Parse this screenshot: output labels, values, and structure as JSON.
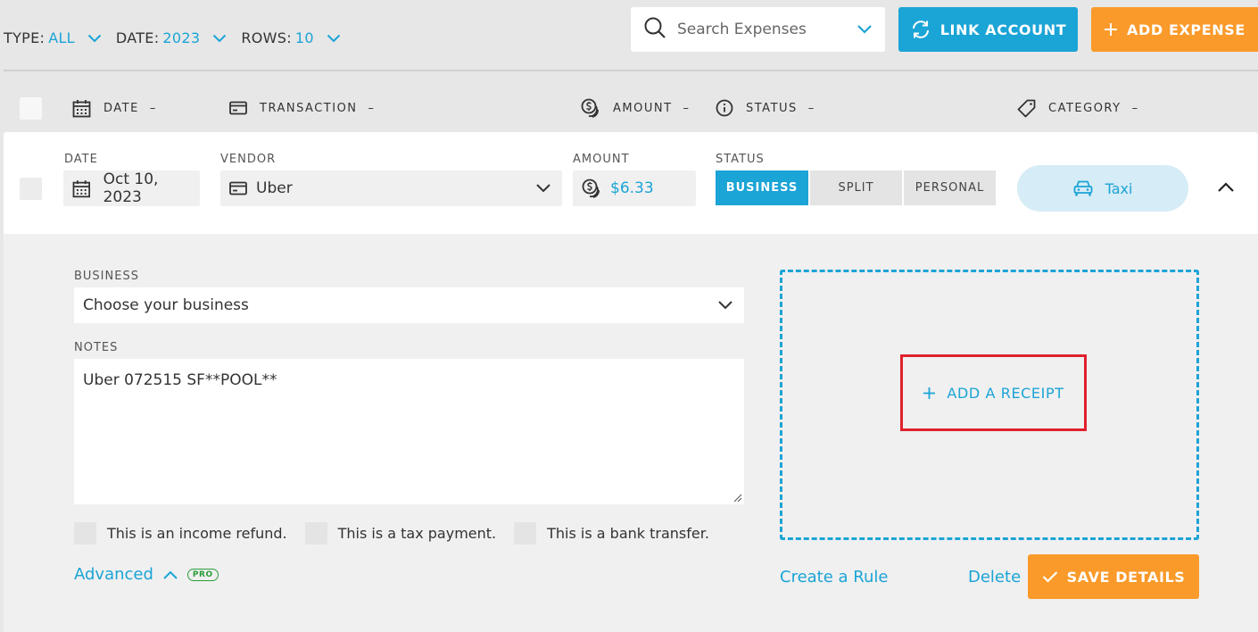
{
  "filters": [
    {
      "key": "TYPE:",
      "value": "ALL"
    },
    {
      "key": "DATE:",
      "value": "2023"
    },
    {
      "key": "ROWS:",
      "value": "10"
    }
  ],
  "search": {
    "placeholder": "Search Expenses"
  },
  "toolbar": {
    "link_account": "LINK ACCOUNT",
    "add_expense": "ADD EXPENSE"
  },
  "columns": {
    "date": "DATE",
    "transaction": "TRANSACTION",
    "amount": "AMOUNT",
    "status": "STATUS",
    "category": "CATEGORY",
    "sort_indicator": "–"
  },
  "expense": {
    "labels": {
      "date": "DATE",
      "vendor": "VENDOR",
      "amount": "AMOUNT",
      "status": "STATUS"
    },
    "date": "Oct 10, 2023",
    "vendor": "Uber",
    "amount": "$6.33",
    "status_options": [
      "BUSINESS",
      "SPLIT",
      "PERSONAL"
    ],
    "status_selected": "BUSINESS",
    "category": "Taxi"
  },
  "details": {
    "business_label": "BUSINESS",
    "business_value": "Choose your business",
    "notes_label": "NOTES",
    "notes_value": "Uber 072515 SF**POOL**",
    "checkboxes": [
      "This is an income refund.",
      "This is a tax payment.",
      "This is a bank transfer."
    ],
    "advanced": "Advanced",
    "pro_badge": "PRO",
    "add_receipt": "ADD A RECEIPT",
    "create_rule": "Create a Rule",
    "delete": "Delete",
    "save": "SAVE DETAILS"
  },
  "colors": {
    "accent": "#1ba4d6",
    "orange": "#fa9a2a",
    "highlight": "#e0202c",
    "pro": "#2a9d3a"
  }
}
